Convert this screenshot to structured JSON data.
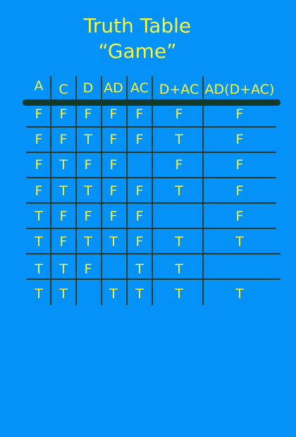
{
  "title": {
    "line1": "Truth Table",
    "line2": "“Game”"
  },
  "table": {
    "headers": [
      "A",
      "C",
      "D",
      "AD",
      "AC",
      "D+AC",
      "AD(D+AC)"
    ],
    "rows": [
      [
        "F",
        "F",
        "F",
        "F",
        "F",
        "F",
        "F"
      ],
      [
        "F",
        "F",
        "T",
        "F",
        "F",
        "T",
        "F"
      ],
      [
        "F",
        "T",
        "F",
        "F",
        "",
        "F",
        "F"
      ],
      [
        "F",
        "T",
        "T",
        "F",
        "F",
        "T",
        "F"
      ],
      [
        "T",
        "F",
        "F",
        "F",
        "F",
        "",
        "F"
      ],
      [
        "T",
        "F",
        "T",
        "T",
        "F",
        "T",
        "T"
      ],
      [
        "T",
        "T",
        "F",
        "",
        "T",
        "T",
        ""
      ],
      [
        "T",
        "T",
        "",
        "T",
        "T",
        "T",
        "T"
      ]
    ]
  },
  "colors": {
    "background": "#0592f8",
    "text": "#f5f542",
    "lines": "#1c3a28"
  }
}
